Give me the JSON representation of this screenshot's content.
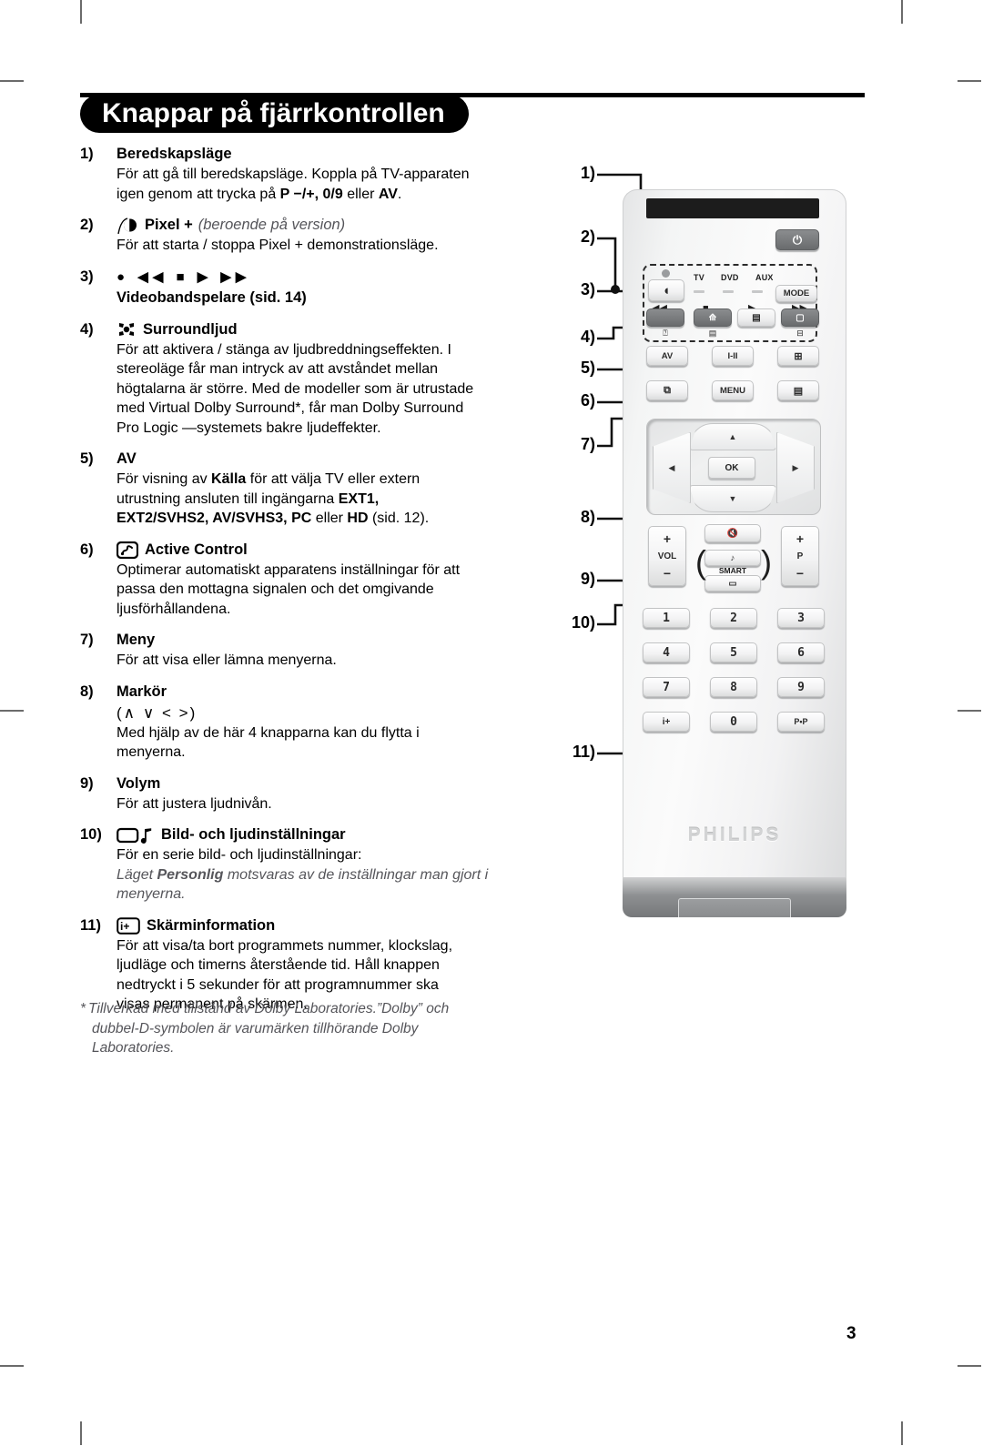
{
  "page": {
    "title": "Knappar på fjärrkontrollen",
    "number": "3"
  },
  "entries": [
    {
      "num": "1)",
      "icon": null,
      "title": "Beredskapsläge",
      "note": null,
      "subtitle": null,
      "lines": [
        "För att gå till beredskapsläge. Koppla på TV-apparaten",
        "igen genom att trycka på <b>P −/+, 0/9</b> eller <b>AV</b>."
      ]
    },
    {
      "num": "2)",
      "icon": "pixel-plus-icon",
      "title": "Pixel +",
      "note": "(beroende på version)",
      "subtitle": null,
      "lines": [
        "För att starta / stoppa Pixel + demonstrationsläge."
      ]
    },
    {
      "num": "3)",
      "icon": "vcr-transport-icons",
      "title": "",
      "glyphs": "● ◀◀ ■ ▶ ▶▶",
      "note": null,
      "subtitle": "Videobandspelare (sid. 14)",
      "lines": []
    },
    {
      "num": "4)",
      "icon": "surround-sound-icon",
      "title": "Surroundljud",
      "note": null,
      "subtitle": null,
      "lines": [
        "För att aktivera / stänga av ljudbreddningseffekten. I",
        "stereoläge får man intryck av att avståndet mellan",
        "högtalarna är större. Med de modeller som är utrustade",
        "med Virtual Dolby Surround*, får man Dolby Surround",
        "Pro Logic —systemets bakre ljudeffekter."
      ]
    },
    {
      "num": "5)",
      "icon": null,
      "title": "AV",
      "note": null,
      "subtitle": null,
      "lines": [
        "För visning av <b>Källa</b> för att välja TV eller extern",
        "utrustning ansluten till ingängarna <b>EXT1,</b>",
        "<b>EXT2/SVHS2, AV/SVHS3, PC</b> eller <b>HD</b> (sid. 12)."
      ]
    },
    {
      "num": "6)",
      "icon": "active-control-icon",
      "title": "Active Control",
      "note": null,
      "subtitle": null,
      "lines": [
        "Optimerar automatiskt apparatens inställningar för att",
        "passa den mottagna signalen och det omgivande",
        "ljusförhållandena."
      ]
    },
    {
      "num": "7)",
      "icon": null,
      "title": "Meny",
      "note": null,
      "subtitle": null,
      "lines": [
        "För att visa eller lämna menyerna."
      ]
    },
    {
      "num": "8)",
      "icon": null,
      "title": "Markör",
      "note": null,
      "cursor_glyphs": "(∧ ∨ < >)",
      "subtitle": null,
      "lines": [
        "Med hjälp av de här 4 knapparna kan du flytta i",
        "menyerna."
      ]
    },
    {
      "num": "9)",
      "icon": null,
      "title": "Volym",
      "note": null,
      "subtitle": null,
      "lines": [
        "För att justera ljudnivån."
      ]
    },
    {
      "num": "10)",
      "icon": "picture-sound-icon",
      "title": "Bild- och ljudinställningar",
      "note": null,
      "subtitle": null,
      "lines": [
        "För en serie bild- och ljudinställningar:",
        "<span class=\"it\">Läget <b>Personlig</b> motsvaras av de inställningar man gjort i</span>",
        "<span class=\"it\">menyerna.</span>"
      ]
    },
    {
      "num": "11)",
      "icon": "screen-info-icon",
      "title": "Skärminformation",
      "note": null,
      "subtitle": null,
      "lines": [
        "För att visa/ta bort programmets nummer, klockslag,",
        "ljudläge och timerns återstående tid. Håll knappen",
        "nedtryckt i 5 sekunder för att programnummer ska",
        "visas permanent på skärmen."
      ]
    }
  ],
  "footnote": {
    "star": "*",
    "lines": [
      "Tillverkad med tillstånd av Dolby Laboratories.”Dolby” och",
      "dubbel-D-symbolen är varumärken tillhörande Dolby",
      "Laboratories."
    ]
  },
  "diagram": {
    "callouts": [
      "1)",
      "2)",
      "3)",
      "4)",
      "5)",
      "6)",
      "7)",
      "8)",
      "9)",
      "10)",
      "11)"
    ],
    "brand": "PHILIPS",
    "source_labels": [
      "TV",
      "DVD",
      "AUX"
    ],
    "mode_label": "MODE",
    "vcr_symbols": [
      "◀◀",
      "■",
      "▶",
      "▶▶"
    ],
    "row3_labels": [
      "AV",
      "I-II",
      "⊞"
    ],
    "row4_labels": [
      "⧉",
      "MENU",
      "▤"
    ],
    "nav": {
      "up": "▲",
      "down": "▼",
      "left": "◀",
      "right": "▶",
      "ok": "OK"
    },
    "vol": {
      "plus": "+",
      "label": "VOL",
      "minus": "−"
    },
    "prog": {
      "plus": "+",
      "label": "P",
      "minus": "−"
    },
    "mute_label": "🔇",
    "smart": {
      "label": "SMART",
      "top": "♪",
      "bottom": "▭"
    },
    "numpad": [
      "1",
      "2",
      "3",
      "4",
      "5",
      "6",
      "7",
      "8",
      "9"
    ],
    "bottom_row": [
      "i+",
      "0",
      "P•P"
    ]
  }
}
